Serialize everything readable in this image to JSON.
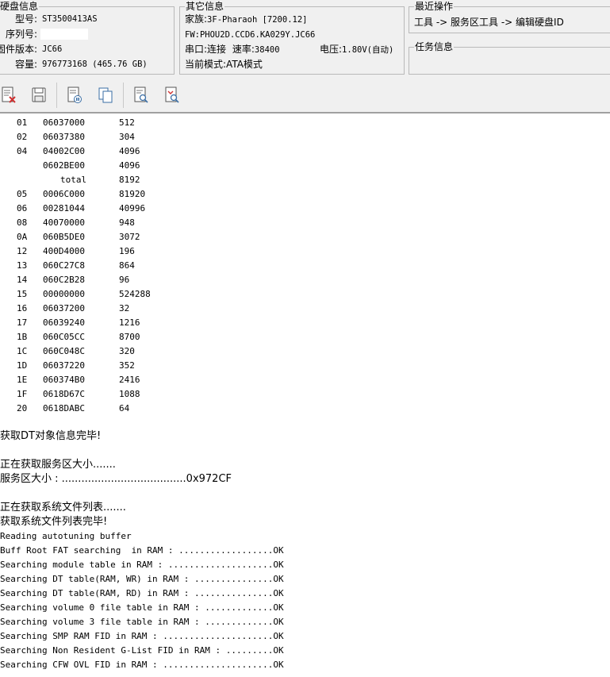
{
  "disk_info": {
    "title": "硬盘信息",
    "model_label": "型号:",
    "model_value": "ST3500413AS",
    "serial_label": "序列号:",
    "serial_value": "",
    "firmware_label": "固件版本:",
    "firmware_value": "JC66",
    "capacity_label": "容量:",
    "capacity_value": "976773168 (465.76 GB)"
  },
  "other_info": {
    "title": "其它信息",
    "family_label": "家族:",
    "family_value": "3F-Pharaoh [7200.12]",
    "fw_line": "FW:PHOU2D.CCD6.KA029Y.JC66",
    "port_label": "串口:连接",
    "baud_label": "速率:",
    "baud_value": "38400",
    "voltage_label": "电压:",
    "voltage_value": "1.80V(自动)",
    "mode_label": "当前模式:",
    "mode_value": "ATA模式"
  },
  "recent_ops": {
    "title": "最近操作",
    "path": "工具 -> 服务区工具 -> 编辑硬盘ID"
  },
  "task_info": {
    "title": "任务信息"
  },
  "toolbar": {
    "icons": [
      "clear-log-icon",
      "save-log-icon",
      "select-all-icon",
      "copy-icon",
      "find-icon",
      "find-next-icon"
    ]
  },
  "dt_table": [
    {
      "id": "01",
      "addr": "06037000",
      "size": "512"
    },
    {
      "id": "02",
      "addr": "06037380",
      "size": "304"
    },
    {
      "id": "04",
      "addr": "04002C00",
      "size": "4096"
    },
    {
      "id": "",
      "addr": "0602BE00",
      "size": "4096"
    },
    {
      "id": "",
      "addr": "total",
      "size": "8192"
    },
    {
      "id": "05",
      "addr": "0006C000",
      "size": "81920"
    },
    {
      "id": "06",
      "addr": "00281044",
      "size": "40996"
    },
    {
      "id": "08",
      "addr": "40070000",
      "size": "948"
    },
    {
      "id": "0A",
      "addr": "060B5DE0",
      "size": "3072"
    },
    {
      "id": "12",
      "addr": "400D4000",
      "size": "196"
    },
    {
      "id": "13",
      "addr": "060C27C8",
      "size": "864"
    },
    {
      "id": "14",
      "addr": "060C2B28",
      "size": "96"
    },
    {
      "id": "15",
      "addr": "00000000",
      "size": "524288"
    },
    {
      "id": "16",
      "addr": "06037200",
      "size": "32"
    },
    {
      "id": "17",
      "addr": "06039240",
      "size": "1216"
    },
    {
      "id": "1B",
      "addr": "060C05CC",
      "size": "8700"
    },
    {
      "id": "1C",
      "addr": "060C048C",
      "size": "320"
    },
    {
      "id": "1D",
      "addr": "06037220",
      "size": "352"
    },
    {
      "id": "1E",
      "addr": "060374B0",
      "size": "2416"
    },
    {
      "id": "1F",
      "addr": "0618D67C",
      "size": "1088"
    },
    {
      "id": "20",
      "addr": "0618DABC",
      "size": "64"
    }
  ],
  "log_lines": [
    {
      "text": "获取DT对象信息完毕!",
      "cn": true
    },
    {
      "text": "正在获取服务区大小.......",
      "cn": true
    },
    {
      "text": "服务区大小 : ......................................0x972CF",
      "cn": true
    },
    {
      "text": "正在获取系统文件列表.......",
      "cn": true
    },
    {
      "text": "获取系统文件列表完毕!",
      "cn": true
    },
    {
      "text": "Reading autotuning buffer",
      "cn": false
    },
    {
      "text": "Buff Root FAT searching  in RAM : ..................OK",
      "cn": false
    },
    {
      "text": "Searching module table in RAM : ....................OK",
      "cn": false
    },
    {
      "text": "Searching DT table(RAM, WR) in RAM : ...............OK",
      "cn": false
    },
    {
      "text": "Searching DT table(RAM, RD) in RAM : ...............OK",
      "cn": false
    },
    {
      "text": "Searching volume 0 file table in RAM : .............OK",
      "cn": false
    },
    {
      "text": "Searching volume 3 file table in RAM : .............OK",
      "cn": false
    },
    {
      "text": "Searching SMP RAM FID in RAM : .....................OK",
      "cn": false
    },
    {
      "text": "Searching Non Resident G-List FID in RAM : .........OK",
      "cn": false
    },
    {
      "text": "Searching CFW OVL FID in RAM : .....................OK",
      "cn": false
    }
  ]
}
